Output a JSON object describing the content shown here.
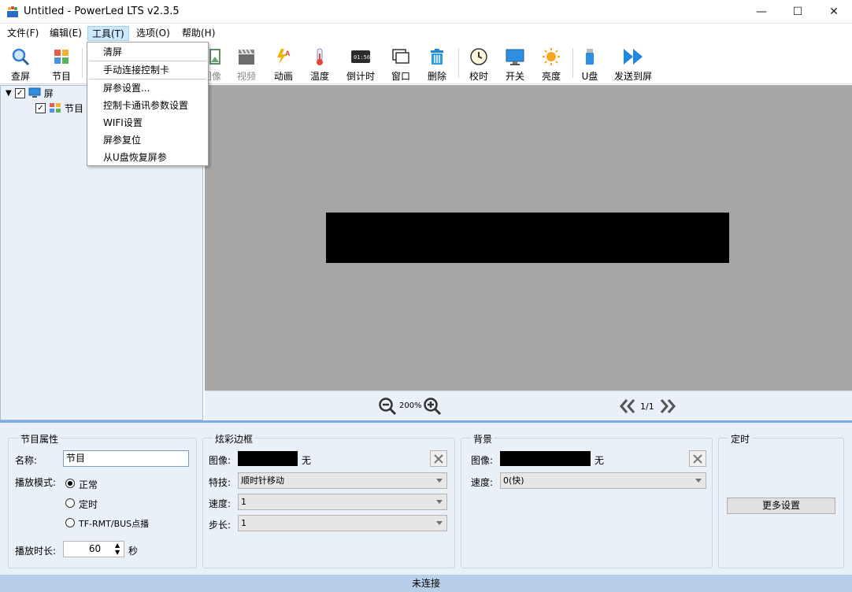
{
  "window": {
    "title": "Untitled - PowerLed LTS v2.3.5",
    "minimize": "—",
    "maximize": "☐",
    "close": "✕"
  },
  "menu": [
    "文件(F)",
    "编辑(E)",
    "工具(T)",
    "选项(O)",
    "帮助(H)"
  ],
  "tools_menu": {
    "items": [
      "清屏",
      "手动连接控制卡",
      "屏参设置...",
      "控制卡通讯参数设置",
      "WIFI设置",
      "屏参复位",
      "从U盘恢复屏参"
    ]
  },
  "toolbar": {
    "query": "查屏",
    "program": "节目",
    "image": "图像",
    "video": "视频",
    "animation": "动画",
    "temperature": "温度",
    "countdown": "倒计时",
    "window": "窗口",
    "delete": "删除",
    "timesync": "校时",
    "power": "开关",
    "brightness": "亮度",
    "udisk": "U盘",
    "send": "发送到屏"
  },
  "tree": {
    "screen": "屏",
    "program": "节目"
  },
  "zoom": {
    "level": "200%",
    "page": "1/1"
  },
  "props": {
    "program_group": "节目属性",
    "name_label": "名称:",
    "name_value": "节目",
    "mode_label": "播放模式:",
    "mode_normal": "正常",
    "mode_timed": "定时",
    "mode_tf": "TF-RMT/BUS点播",
    "duration_label": "播放时长:",
    "duration_value": "60",
    "duration_unit": "秒",
    "border_group": "炫彩边框",
    "border_image_label": "图像:",
    "border_image_value": "无",
    "border_effect_label": "特技:",
    "border_effect_value": "顺时针移动",
    "border_speed_label": "速度:",
    "border_speed_value": "1",
    "border_step_label": "步长:",
    "border_step_value": "1",
    "bg_group": "背景",
    "bg_image_label": "图像:",
    "bg_image_value": "无",
    "bg_speed_label": "速度:",
    "bg_speed_value": "0(快)",
    "timing_group": "定时",
    "more_settings": "更多设置"
  },
  "status": "未连接"
}
